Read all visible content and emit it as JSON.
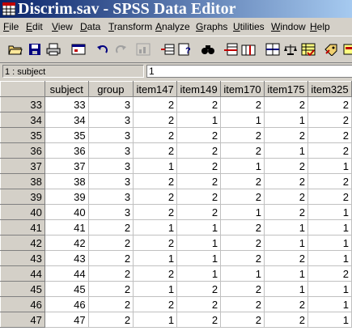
{
  "window": {
    "title": "Discrim.sav - SPSS Data Editor"
  },
  "menu": [
    "File",
    "Edit",
    "View",
    "Data",
    "Transform",
    "Analyze",
    "Graphs",
    "Utilities",
    "Window",
    "Help"
  ],
  "cell_editor": {
    "reference": "1 : subject",
    "value": "1"
  },
  "grid": {
    "columns": [
      "subject",
      "group",
      "item147",
      "item149",
      "item170",
      "item175",
      "item325"
    ],
    "rows": [
      {
        "n": "33",
        "cells": [
          "33",
          "3",
          "2",
          "2",
          "2",
          "2",
          "2"
        ]
      },
      {
        "n": "34",
        "cells": [
          "34",
          "3",
          "2",
          "1",
          "1",
          "1",
          "2"
        ]
      },
      {
        "n": "35",
        "cells": [
          "35",
          "3",
          "2",
          "2",
          "2",
          "2",
          "2"
        ]
      },
      {
        "n": "36",
        "cells": [
          "36",
          "3",
          "2",
          "2",
          "2",
          "1",
          "2"
        ]
      },
      {
        "n": "37",
        "cells": [
          "37",
          "3",
          "1",
          "2",
          "1",
          "2",
          "1"
        ]
      },
      {
        "n": "38",
        "cells": [
          "38",
          "3",
          "2",
          "2",
          "2",
          "2",
          "2"
        ]
      },
      {
        "n": "39",
        "cells": [
          "39",
          "3",
          "2",
          "2",
          "2",
          "2",
          "2"
        ]
      },
      {
        "n": "40",
        "cells": [
          "40",
          "3",
          "2",
          "2",
          "1",
          "2",
          "1"
        ]
      },
      {
        "n": "41",
        "cells": [
          "41",
          "2",
          "1",
          "1",
          "2",
          "1",
          "1"
        ]
      },
      {
        "n": "42",
        "cells": [
          "42",
          "2",
          "2",
          "1",
          "2",
          "1",
          "1"
        ]
      },
      {
        "n": "43",
        "cells": [
          "43",
          "2",
          "1",
          "1",
          "2",
          "2",
          "1"
        ]
      },
      {
        "n": "44",
        "cells": [
          "44",
          "2",
          "2",
          "1",
          "1",
          "1",
          "2"
        ]
      },
      {
        "n": "45",
        "cells": [
          "45",
          "2",
          "1",
          "2",
          "2",
          "1",
          "1"
        ]
      },
      {
        "n": "46",
        "cells": [
          "46",
          "2",
          "2",
          "2",
          "2",
          "2",
          "1"
        ]
      },
      {
        "n": "47",
        "cells": [
          "47",
          "2",
          "1",
          "2",
          "2",
          "2",
          "1"
        ]
      }
    ]
  },
  "toolbar_icons": [
    "open-folder-icon",
    "save-icon",
    "print-icon",
    "dialog-recall-icon",
    "undo-icon",
    "redo-icon",
    "goto-chart-icon",
    "goto-case-icon",
    "variables-icon",
    "find-icon",
    "insert-case-icon",
    "insert-variable-icon",
    "split-file-icon",
    "weight-cases-icon",
    "select-cases-icon",
    "value-labels-icon",
    "use-sets-icon"
  ]
}
